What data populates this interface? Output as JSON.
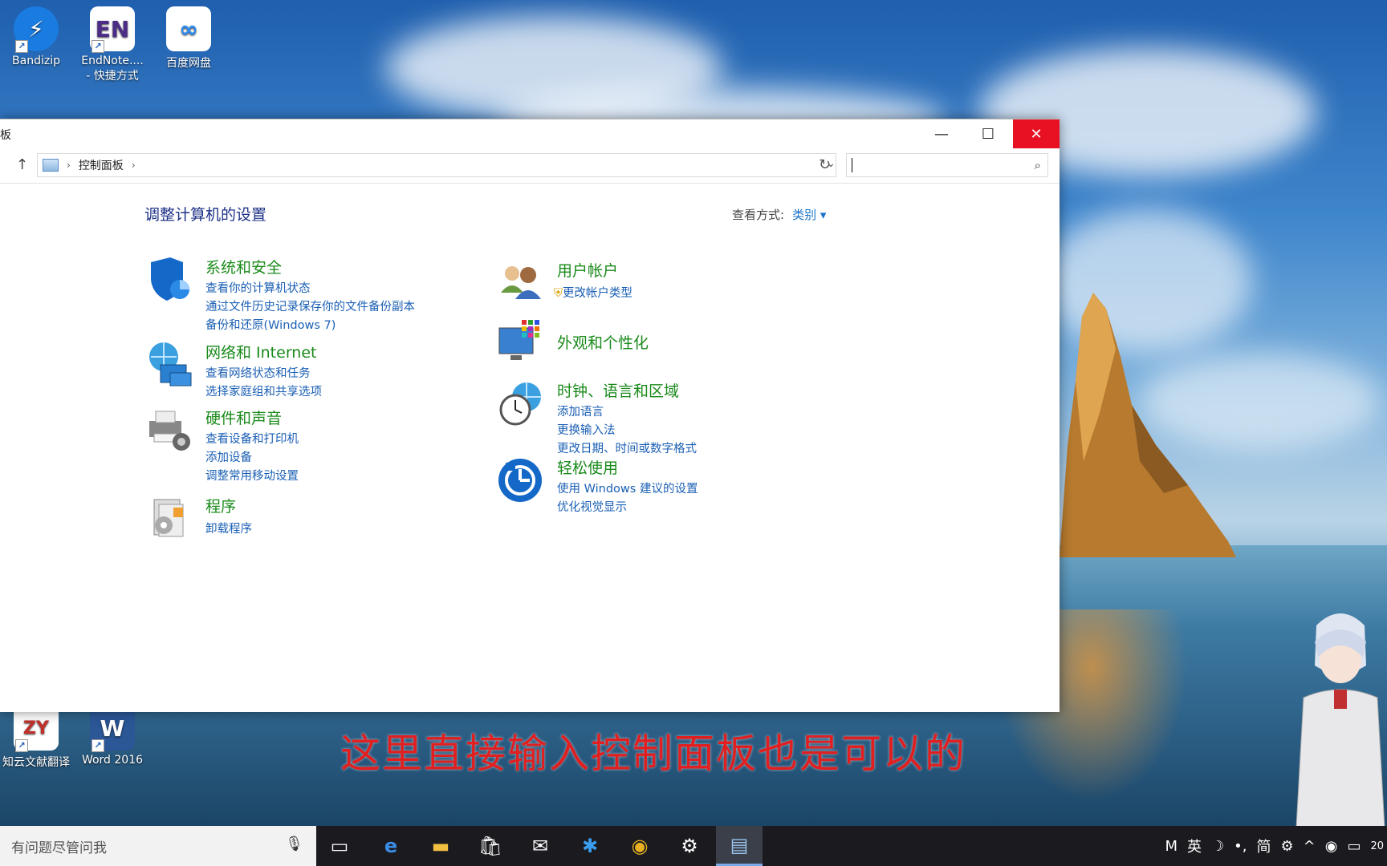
{
  "desktop": {
    "icons": [
      {
        "label": "Bandizip",
        "glyph": "⚡"
      },
      {
        "label": "EndNote....",
        "label2": "- 快捷方式",
        "glyph": "EN"
      },
      {
        "label": "百度网盘",
        "glyph": "∞"
      },
      {
        "label": "知云文献翻译",
        "glyph": "ZY"
      },
      {
        "label": "Word 2016",
        "glyph": "W"
      }
    ]
  },
  "window": {
    "title": "板",
    "breadcrumb": "控制面板",
    "search_placeholder": "",
    "heading": "调整计算机的设置",
    "view_by_label": "查看方式:",
    "view_by_value": "类别 ▾",
    "categories_left": [
      {
        "title": "系统和安全",
        "links": [
          "查看你的计算机状态",
          "通过文件历史记录保存你的文件备份副本",
          "备份和还原(Windows 7)"
        ]
      },
      {
        "title": "网络和 Internet",
        "links": [
          "查看网络状态和任务",
          "选择家庭组和共享选项"
        ]
      },
      {
        "title": "硬件和声音",
        "links": [
          "查看设备和打印机",
          "添加设备",
          "调整常用移动设置"
        ]
      },
      {
        "title": "程序",
        "links": [
          "卸载程序"
        ]
      }
    ],
    "categories_right": [
      {
        "title": "用户帐户",
        "links": [
          "更改帐户类型"
        ]
      },
      {
        "title": "外观和个性化",
        "links": []
      },
      {
        "title": "时钟、语言和区域",
        "links": [
          "添加语言",
          "更换输入法",
          "更改日期、时间或数字格式"
        ]
      },
      {
        "title": "轻松使用",
        "links": [
          "使用 Windows 建议的设置",
          "优化视觉显示"
        ]
      }
    ]
  },
  "subtitle": "这里直接输入控制面板也是可以的",
  "taskbar": {
    "search_placeholder": "有问题尽管问我",
    "tray": [
      "M",
      "英",
      "☽",
      "•,",
      "简",
      "⚙",
      "^",
      "◉",
      "▭"
    ],
    "clock": "20"
  },
  "colors": {
    "close": "#e81123",
    "category_title": "#1a8a1a",
    "link": "#1a5fb4",
    "subtitle": "#e02020"
  }
}
